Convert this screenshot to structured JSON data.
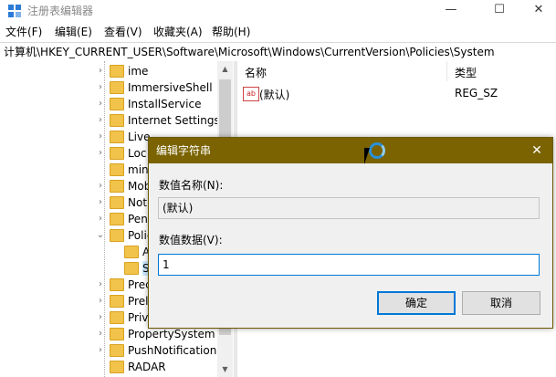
{
  "window": {
    "title": "注册表编辑器",
    "icon": "registry-editor-icon",
    "controls": {
      "minimize": "—",
      "maximize": "☐",
      "close": "✕"
    }
  },
  "menu": [
    "文件(F)",
    "编辑(E)",
    "查看(V)",
    "收藏夹(A)",
    "帮助(H)"
  ],
  "address": "计算机\\HKEY_CURRENT_USER\\Software\\Microsoft\\Windows\\CurrentVersion\\Policies\\System",
  "tree": {
    "items": [
      {
        "label": "ime",
        "expander": "›"
      },
      {
        "label": "ImmersiveShell",
        "expander": "›"
      },
      {
        "label": "InstallService",
        "expander": "›"
      },
      {
        "label": "Internet Settings",
        "expander": "›"
      },
      {
        "label": "Live",
        "expander": "›"
      },
      {
        "label": "Loc",
        "expander": "›"
      },
      {
        "label": "min",
        "expander": ""
      },
      {
        "label": "Mob",
        "expander": "›"
      },
      {
        "label": "Noti",
        "expander": "›"
      },
      {
        "label": "Pen",
        "expander": "›"
      },
      {
        "label": "Polic",
        "expander": "⌄"
      },
      {
        "label": "A",
        "expander": ""
      },
      {
        "label": "S",
        "expander": ""
      },
      {
        "label": "Prec",
        "expander": "›"
      },
      {
        "label": "Prel",
        "expander": "›"
      },
      {
        "label": "Priv",
        "expander": "›"
      },
      {
        "label": "PropertySystem",
        "expander": "›"
      },
      {
        "label": "PushNotifications",
        "expander": "›"
      },
      {
        "label": "RADAR",
        "expander": ""
      }
    ]
  },
  "values": {
    "headers": {
      "name": "名称",
      "type": "类型"
    },
    "rows": [
      {
        "name": "(默认)",
        "type": "REG_SZ",
        "icon_text": "ab"
      }
    ]
  },
  "dialog": {
    "title": "编辑字符串",
    "close": "✕",
    "name_label": "数值名称(N):",
    "name_value": "(默认)",
    "data_label": "数值数据(V):",
    "data_value": "1",
    "ok": "确定",
    "cancel": "取消"
  },
  "colors": {
    "dialog_title": "#7a6300",
    "accent": "#0078d7",
    "folder": "#f1c34a"
  }
}
